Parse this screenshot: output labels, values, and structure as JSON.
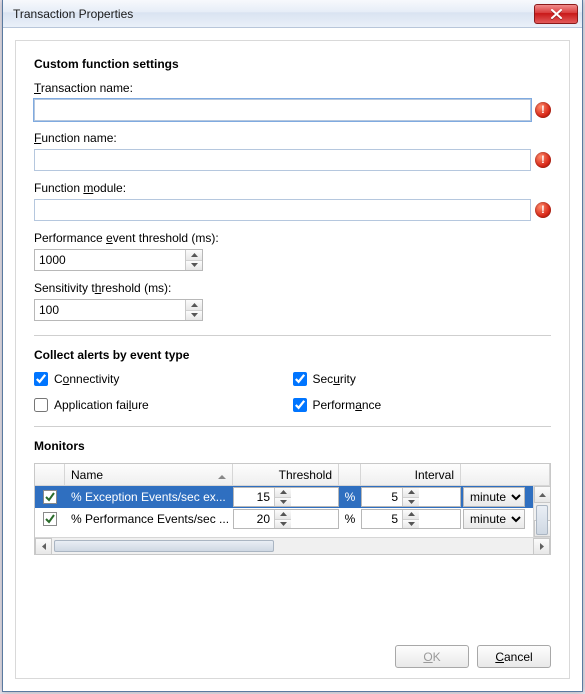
{
  "window": {
    "title": "Transaction Properties"
  },
  "sections": {
    "custom": {
      "heading": "Custom function settings",
      "transaction_label_pre": "",
      "transaction_label_u": "T",
      "transaction_label_post": "ransaction name:",
      "transaction_value": "",
      "function_label_pre": "",
      "function_label_u": "F",
      "function_label_post": "unction name:",
      "function_value": "",
      "module_label_pre": "Function ",
      "module_label_u": "m",
      "module_label_post": "odule:",
      "module_value": "",
      "perf_label_pre": "Performance ",
      "perf_label_u": "e",
      "perf_label_post": "vent threshold (ms):",
      "perf_value": "1000",
      "sens_label_pre": "Sensitivity t",
      "sens_label_u": "h",
      "sens_label_post": "reshold (ms):",
      "sens_value": "100"
    },
    "collect": {
      "heading": "Collect alerts by event type",
      "connectivity": {
        "label": "Connectivity",
        "u": "o",
        "rest": "nnectivity",
        "checked": true
      },
      "security": {
        "pre": "Sec",
        "u": "u",
        "post": "rity",
        "checked": true
      },
      "appfail": {
        "pre": "Application fai",
        "u": "l",
        "post": "ure",
        "checked": false
      },
      "performance": {
        "pre": "Perform",
        "u": "a",
        "post": "nce",
        "checked": true
      }
    },
    "monitors": {
      "heading": "Monitors",
      "columns": {
        "name": "Name",
        "threshold": "Threshold",
        "interval": "Interval",
        "pct": "%"
      },
      "interval_unit": "minutes",
      "rows": [
        {
          "enabled": true,
          "name": "% Exception Events/sec ex...",
          "threshold": "15",
          "interval": "5",
          "selected": true
        },
        {
          "enabled": true,
          "name": "% Performance Events/sec ...",
          "threshold": "20",
          "interval": "5",
          "selected": false
        }
      ]
    }
  },
  "footer": {
    "ok_u": "O",
    "ok_rest": "K",
    "cancel_u": "C",
    "cancel_rest": "ancel",
    "ok_enabled": false
  }
}
